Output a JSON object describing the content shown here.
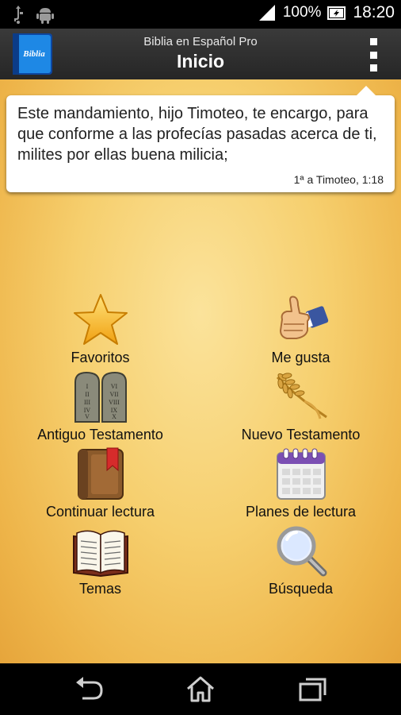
{
  "status_bar": {
    "battery": "100%",
    "time": "18:20",
    "icons": [
      "usb-icon",
      "android-icon",
      "signal-icon",
      "battery-icon"
    ]
  },
  "action_bar": {
    "app_name": "Biblia en Español Pro",
    "title": "Inicio",
    "app_icon_text": "Biblia"
  },
  "verse": {
    "text": "Este mandamiento, hijo Timoteo, te encargo, para que conforme a las profecías pasadas acerca de ti, milites por ellas buena milicia;",
    "reference": "1ª a Timoteo, 1:18"
  },
  "menu": {
    "favoritos": "Favoritos",
    "me_gusta": "Me gusta",
    "antiguo": "Antiguo Testamento",
    "nuevo": "Nuevo Testamento",
    "continuar": "Continuar lectura",
    "planes": "Planes de lectura",
    "temas": "Temas",
    "busqueda": "Búsqueda"
  },
  "tablets_numerals": [
    "I",
    "II",
    "III",
    "IV",
    "V",
    "VI",
    "VII",
    "VIII",
    "IX",
    "X"
  ]
}
